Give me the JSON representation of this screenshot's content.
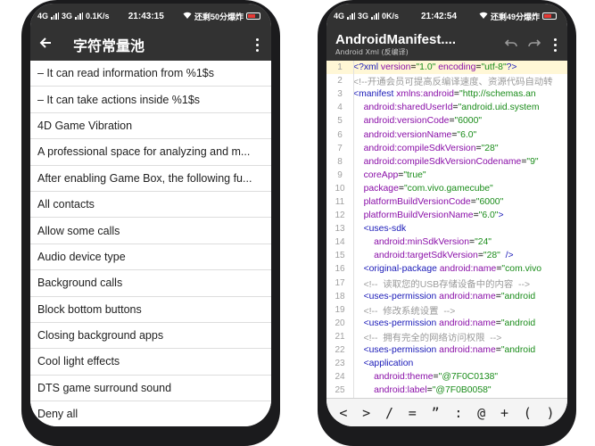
{
  "left": {
    "status": {
      "network": "4G",
      "network2": "3G",
      "speed": "0.1K/s",
      "time": "21:43:15",
      "carrier": "还剩50分爆炸"
    },
    "toolbar": {
      "title": "字符常量池"
    },
    "items": [
      "– It can read information from %1$s",
      "– It can take actions inside %1$s",
      "4D Game Vibration",
      "A professional space for analyzing and m...",
      "After enabling Game Box, the following fu...",
      "All contacts",
      "Allow some calls",
      "Audio device type",
      "Background calls",
      "Block bottom buttons",
      "Closing background apps",
      "Cool light effects",
      "DTS game surround sound",
      "Deny all"
    ]
  },
  "right": {
    "status": {
      "network": "4G",
      "network2": "3G",
      "speed": "0K/s",
      "time": "21:42:54",
      "carrier": "还剩49分爆炸"
    },
    "toolbar": {
      "title": "AndroidManifest....",
      "subtitle": "Android Xml (反编译)"
    },
    "symbols": [
      "<",
      ">",
      "/",
      "=",
      "”",
      ":",
      "@",
      "+",
      "(",
      ")"
    ]
  }
}
